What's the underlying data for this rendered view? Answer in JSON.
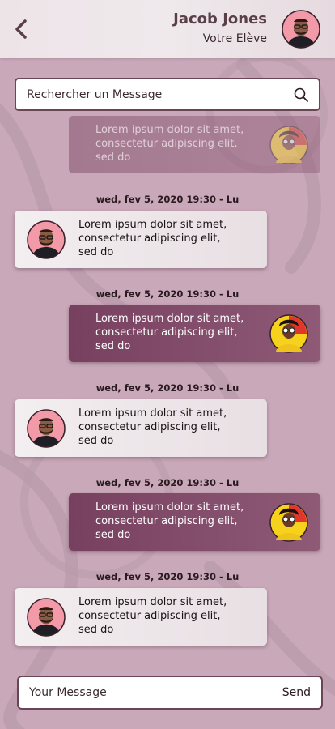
{
  "header": {
    "name": "Jacob Jones",
    "role": "Votre Elève"
  },
  "search": {
    "placeholder": "Rechercher un Message",
    "icon": "search-icon"
  },
  "messages": [
    {
      "direction": "out",
      "faded": true,
      "lines": [
        "Lorem ipsum dolor sit amet,",
        "consectetur adipiscing elit,",
        "sed do"
      ],
      "avatar": "student-avatar"
    },
    {
      "timestamp": "wed, fev 5, 2020 19:30 - Lu",
      "direction": "in",
      "lines": [
        "Lorem ipsum dolor sit amet,",
        "consectetur adipiscing elit,",
        "sed do"
      ],
      "avatar": "teacher-avatar"
    },
    {
      "timestamp": "wed, fev 5, 2020 19:30 - Lu",
      "direction": "out",
      "lines": [
        "Lorem ipsum dolor sit amet,",
        "consectetur adipiscing elit,",
        "sed do"
      ],
      "avatar": "student-avatar"
    },
    {
      "timestamp": "wed, fev 5, 2020 19:30 - Lu",
      "direction": "in",
      "lines": [
        "Lorem ipsum dolor sit amet,",
        "consectetur adipiscing elit,",
        "sed do"
      ],
      "avatar": "teacher-avatar"
    },
    {
      "timestamp": "wed, fev 5, 2020 19:30 - Lu",
      "direction": "out",
      "lines": [
        "Lorem ipsum dolor sit amet,",
        "consectetur adipiscing elit,",
        "sed do"
      ],
      "avatar": "student-avatar"
    },
    {
      "timestamp": "wed, fev 5, 2020 19:30 - Lu",
      "direction": "in",
      "lines": [
        "Lorem ipsum dolor sit amet,",
        "consectetur adipiscing elit,",
        "sed do"
      ],
      "avatar": "teacher-avatar"
    }
  ],
  "composer": {
    "placeholder": "Your Message",
    "send_label": "Send"
  },
  "colors": {
    "background": "#c9a9b9",
    "accent": "#77405f",
    "border": "#6a4555"
  }
}
